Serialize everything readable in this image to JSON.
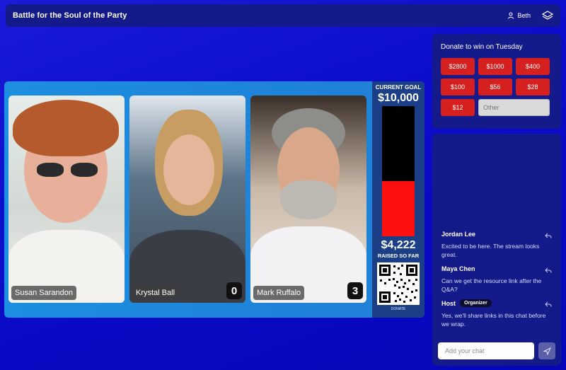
{
  "header": {
    "title": "Battle for the Soul of the Party",
    "user_name": "Beth"
  },
  "stage": {
    "participants": [
      {
        "name": "Susan Sarandon",
        "count": ""
      },
      {
        "name": "Krystal Ball",
        "count": "0"
      },
      {
        "name": "Mark Ruffalo",
        "count": "3"
      }
    ],
    "goal": {
      "goal_label": "CURRENT GOAL",
      "goal_value": "$10,000",
      "raised_value": "$4,222",
      "raised_label": "RAISED SO FAR",
      "progress_fraction": 0.4222,
      "qr_caption": "DONATE",
      "fill_color": "#ff1010"
    }
  },
  "donate": {
    "title": "Donate to win on Tuesday",
    "amounts": [
      "$2800",
      "$1000",
      "$400",
      "$100",
      "$56",
      "$28",
      "$12"
    ],
    "other_placeholder": "Other"
  },
  "chat": {
    "messages": [
      {
        "author": "Jordan Lee",
        "badge": "",
        "text": "Excited to be here. The stream looks great."
      },
      {
        "author": "Maya Chen",
        "badge": "",
        "text": "Can we get the resource link after the Q&A?"
      },
      {
        "author": "Host",
        "badge": "Organizer",
        "text": "Yes, we'll share links in this chat before we wrap."
      }
    ],
    "input_placeholder": "Add your chat",
    "icons": {
      "reply": "reply-icon",
      "send": "send-icon"
    }
  }
}
